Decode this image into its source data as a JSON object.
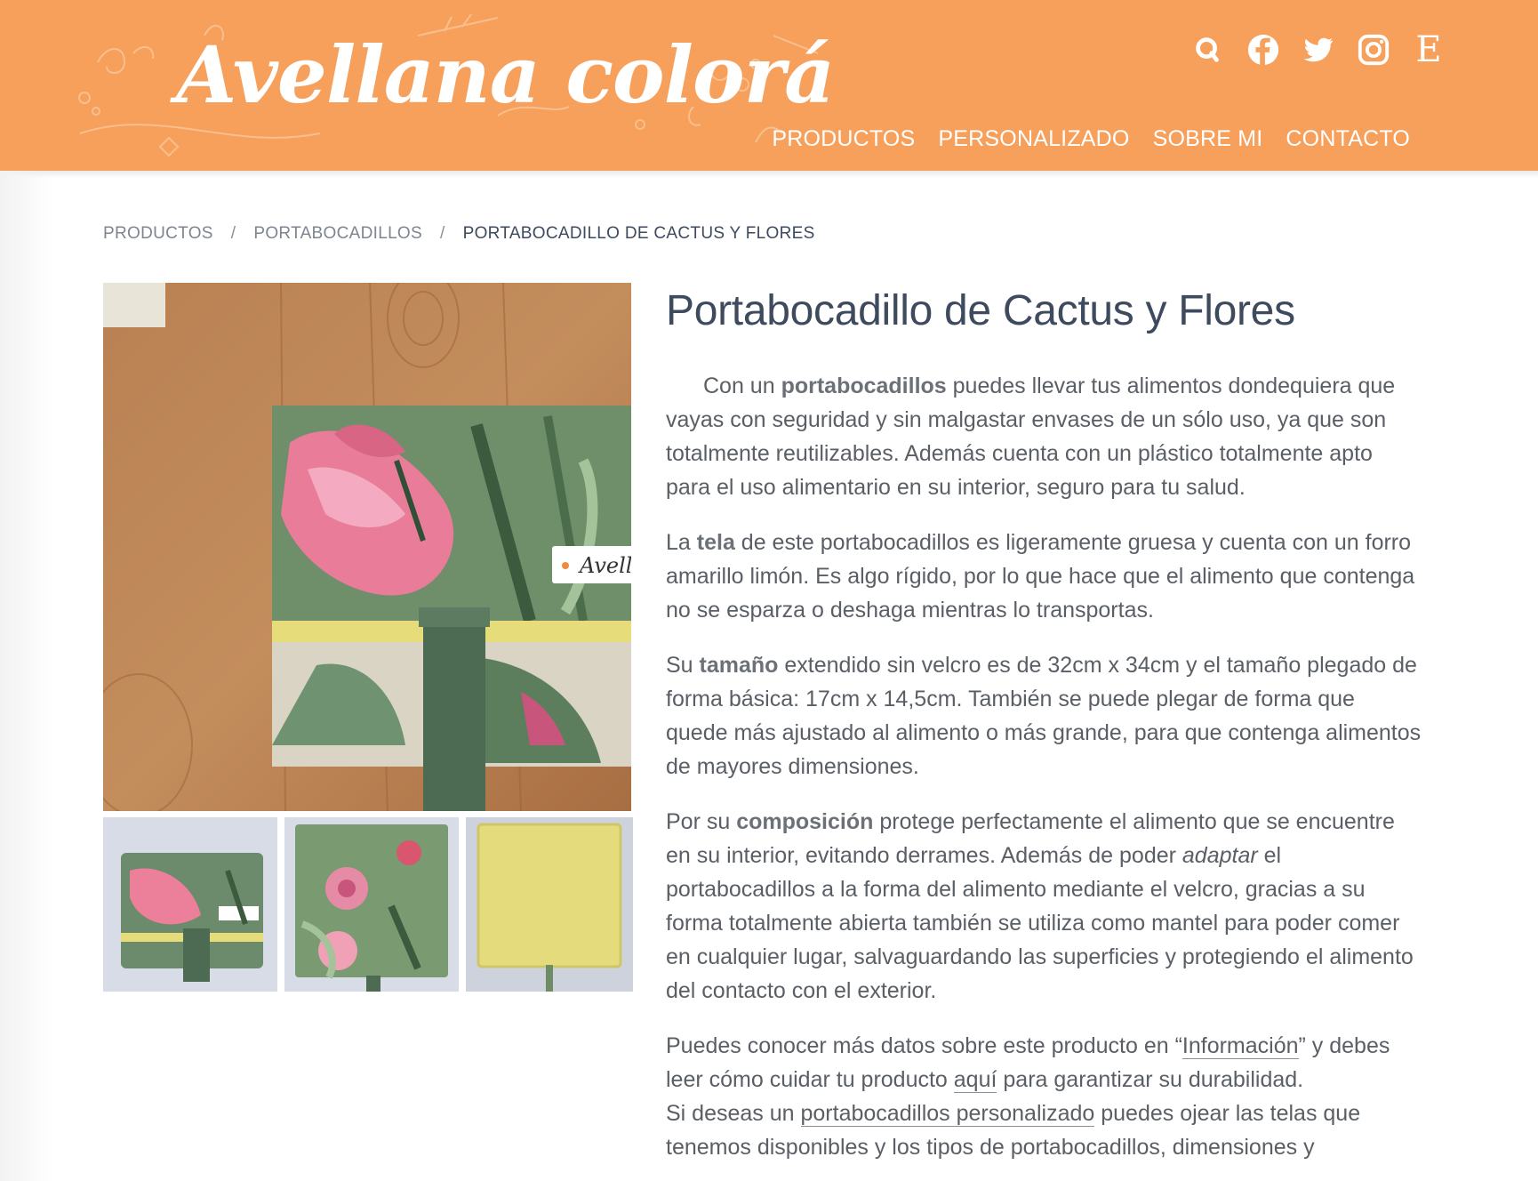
{
  "header": {
    "logo": "Avellana colorá",
    "social": [
      {
        "name": "search-icon"
      },
      {
        "name": "facebook-icon"
      },
      {
        "name": "twitter-icon"
      },
      {
        "name": "instagram-icon"
      },
      {
        "name": "etsy-icon",
        "glyph": "E"
      }
    ],
    "nav": [
      "PRODUCTOS",
      "PERSONALIZADO",
      "SOBRE MI",
      "CONTACTO"
    ],
    "colors": {
      "header_bg": "#f6a05c",
      "text": "#ffffff"
    }
  },
  "breadcrumb": {
    "items": [
      "PRODUCTOS",
      "PORTABOCADILLOS"
    ],
    "separator": "/",
    "current": "PORTABOCADILLO DE CACTUS Y FLORES"
  },
  "product": {
    "title": "Portabocadillo de Cactus y Flores",
    "p1": {
      "a": "Con un ",
      "b": "portabocadillos",
      "c": " puedes llevar tus alimentos dondequiera que vayas con seguridad y sin malgastar envases de un sólo uso, ya que son totalmente reutilizables. Además cuenta con un plástico totalmente apto para el uso alimentario en su interior, seguro para tu salud."
    },
    "p2": {
      "a": "La ",
      "b": "tela",
      "c": " de este portabocadillos es ligeramente gruesa y cuenta con un forro amarillo limón. Es algo rígido, por lo que hace que el alimento que contenga no se esparza o deshaga mientras lo transportas."
    },
    "p3": {
      "a": "Su ",
      "b": "tamaño",
      "c": " extendido sin velcro es de 32cm x 34cm y el tamaño plegado de forma básica: 17cm x 14,5cm. También se puede plegar de forma que quede más ajustado al alimento o más grande, para que contenga alimentos de mayores dimensiones."
    },
    "p4": {
      "a": "Por su ",
      "b": "composición",
      "c": " protege perfectamente el alimento que se encuentre en su interior, evitando derrames. Además de poder ",
      "i": "adaptar",
      "d": " el portabocadillos a la forma del alimento mediante el velcro, gracias a su forma totalmente abierta también se utiliza como mantel para poder comer en cualquier lugar, salvaguardando las superficies y protegiendo el alimento del contacto con el exterior."
    },
    "p5": {
      "a": "Puedes conocer más datos sobre este producto en “",
      "link1": "Información",
      "b": "” y debes leer cómo cuidar tu producto ",
      "link2": "aquí",
      "c": " para garantizar su durabilidad.",
      "d": "Si deseas un ",
      "link3": "portabocadillos personalizado",
      "e": " puedes ojear las telas que tenemos disponibles y los tipos de portabocadillos, dimensiones y"
    },
    "tag_text": "Avell"
  }
}
